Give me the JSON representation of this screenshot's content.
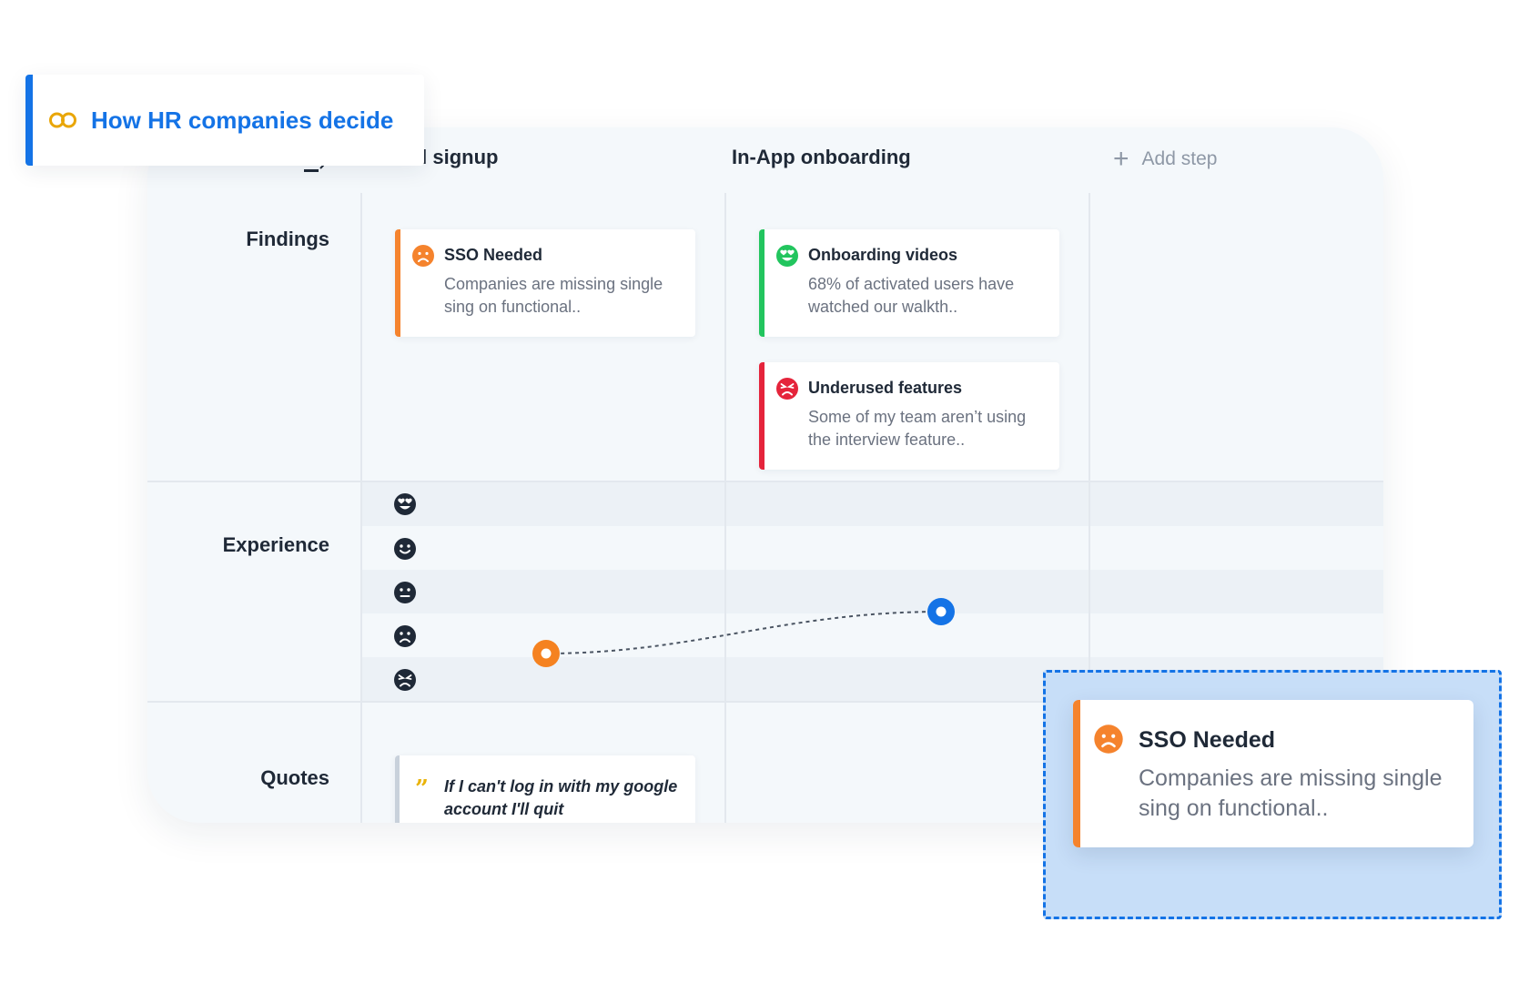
{
  "journey_tab": {
    "label": "How HR companies decide",
    "icon": "link-icon",
    "accent": "#1473e6"
  },
  "columns": [
    {
      "label": "Trial signup"
    },
    {
      "label": "In-App onboarding"
    }
  ],
  "add_step": {
    "label": "Add step"
  },
  "rows": {
    "findings": "Findings",
    "experience": "Experience",
    "quotes": "Quotes"
  },
  "findings": [
    {
      "title": "SSO Needed",
      "desc": "Companies are missing single sing on functional..",
      "sentiment": "sad",
      "color": "#f5832d"
    },
    {
      "title": "Onboarding videos",
      "desc": "68% of activated users have watched our walkth..",
      "sentiment": "love",
      "color": "#22c55e"
    },
    {
      "title": "Underused features",
      "desc": "Some of my team aren’t using the interview feature..",
      "sentiment": "angry",
      "color": "#e5243b"
    }
  ],
  "experience_scale": [
    "love-face-icon",
    "happy-face-icon",
    "neutral-face-icon",
    "sad-face-icon",
    "angry-face-icon"
  ],
  "experience_points": [
    {
      "step": "Trial signup",
      "level": "sad",
      "color": "#f58220"
    },
    {
      "step": "In-App onboarding",
      "level": "neutral",
      "color": "#1473e6"
    }
  ],
  "quotes": [
    {
      "text": "If I can't log in with my google account I'll quit"
    }
  ],
  "dragged_card": {
    "title": "SSO Needed",
    "desc": "Companies are missing single sing on functional..",
    "color": "#f5832d"
  }
}
